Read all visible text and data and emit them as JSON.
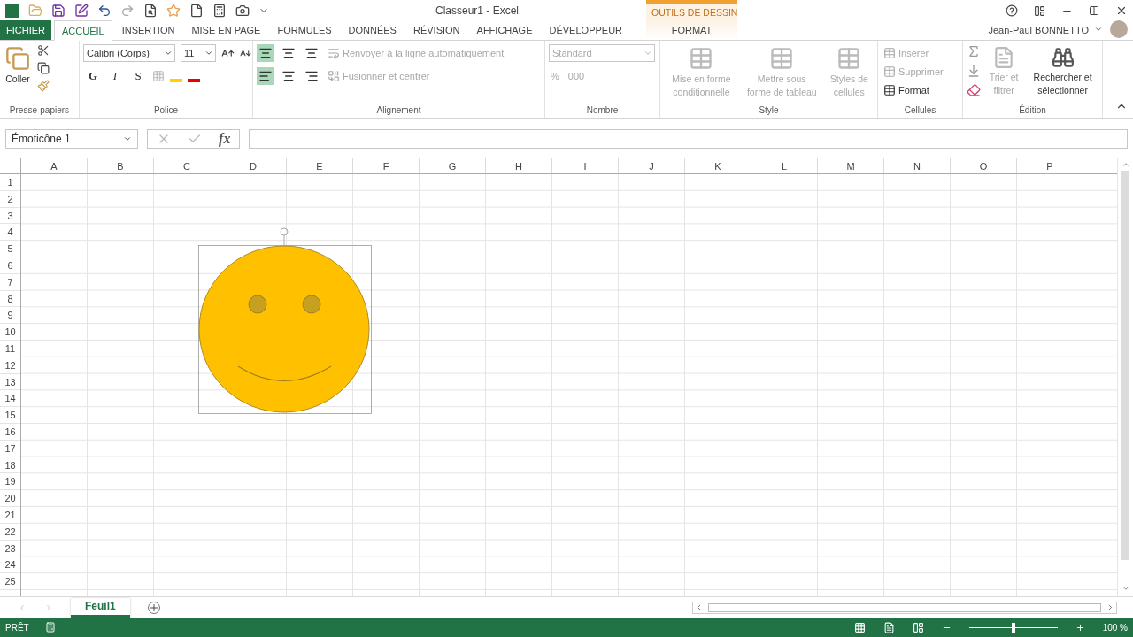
{
  "window": {
    "title": "Classeur1 - Excel",
    "contextual_tab": "OUTILS DE DESSIN",
    "user": "Jean-Paul BONNETTO"
  },
  "tabs": [
    {
      "label": "FICHIER",
      "kind": "file",
      "selected": false
    },
    {
      "label": "ACCUEIL",
      "kind": "normal",
      "selected": true
    },
    {
      "label": "INSERTION",
      "kind": "normal",
      "selected": false
    },
    {
      "label": "MISE EN PAGE",
      "kind": "normal",
      "selected": false
    },
    {
      "label": "FORMULES",
      "kind": "normal",
      "selected": false
    },
    {
      "label": "DONNÉES",
      "kind": "normal",
      "selected": false
    },
    {
      "label": "RÉVISION",
      "kind": "normal",
      "selected": false
    },
    {
      "label": "AFFICHAGE",
      "kind": "normal",
      "selected": false
    },
    {
      "label": "DÉVELOPPEUR",
      "kind": "normal",
      "selected": false
    },
    {
      "label": "FORMAT",
      "kind": "contextual",
      "selected": false
    }
  ],
  "ribbon": {
    "paste": "Coller",
    "font_name": "Calibri (Corps)",
    "font_size": "11",
    "bold": "G",
    "italic": "I",
    "underline": "S",
    "align_buttons": [
      {
        "selected": true
      },
      {
        "selected": false
      },
      {
        "selected": false
      }
    ],
    "halign_buttons": [
      {
        "selected": true
      },
      {
        "selected": false
      },
      {
        "selected": false
      }
    ],
    "wrap_text": {
      "label": "Renvoyer à la ligne automatiquement",
      "disabled": true
    },
    "merge": {
      "label": "Fusionner et centrer",
      "disabled": true
    },
    "number_format": {
      "value": "Standard",
      "disabled": true
    },
    "percent": "%",
    "thousands": "000",
    "style_buttons": [
      {
        "label": "Mise en forme conditionnelle",
        "disabled": true
      },
      {
        "label": "Mettre sous forme de tableau",
        "disabled": true
      },
      {
        "label": "Styles de cellules",
        "disabled": true
      }
    ],
    "cell_buttons": [
      {
        "label": "Insérer",
        "disabled": true
      },
      {
        "label": "Supprimer",
        "disabled": true
      },
      {
        "label": "Format",
        "disabled": false
      }
    ],
    "edit_buttons": [
      {
        "label": "Trier et filtrer",
        "disabled": true
      },
      {
        "label": "Rechercher et sélectionner",
        "disabled": false
      }
    ],
    "groups": [
      "Presse-papiers",
      "Police",
      "Alignement",
      "Nombre",
      "Style",
      "Cellules",
      "Édition"
    ]
  },
  "formula_bar": {
    "name_box": "Émoticône 1",
    "fx": "fx"
  },
  "columns": [
    "A",
    "B",
    "C",
    "D",
    "E",
    "F",
    "G",
    "H",
    "I",
    "J",
    "K",
    "L",
    "M",
    "N",
    "O",
    "P"
  ],
  "rows": [
    "1",
    "2",
    "3",
    "4",
    "5",
    "6",
    "7",
    "8",
    "9",
    "10",
    "11",
    "12",
    "13",
    "14",
    "15",
    "16",
    "17",
    "18",
    "19",
    "20",
    "21",
    "22",
    "23",
    "24",
    "25"
  ],
  "sheets": [
    {
      "label": "Feuil1",
      "selected": true
    }
  ],
  "status_bar": {
    "status": "PRÊT",
    "zoom": "100 %",
    "level": 0.5
  }
}
